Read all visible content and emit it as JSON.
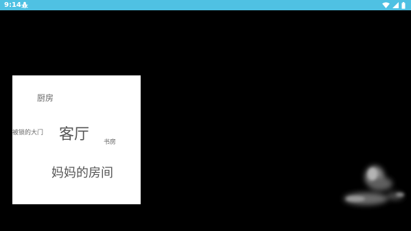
{
  "status_bar": {
    "time": "9:14",
    "left_icon": "bug-icon",
    "right_icons": [
      "wifi-icon",
      "cell-signal-icon",
      "battery-icon"
    ],
    "background": "#4fc1e3"
  },
  "map": {
    "rooms": {
      "kitchen": "厨房",
      "locked_door": "被锁的大门",
      "living_room": "客厅",
      "study": "书房",
      "moms_room": "妈妈的房间"
    }
  },
  "colors": {
    "background": "#000000",
    "map_background": "#ffffff",
    "room_text": "#666666"
  }
}
